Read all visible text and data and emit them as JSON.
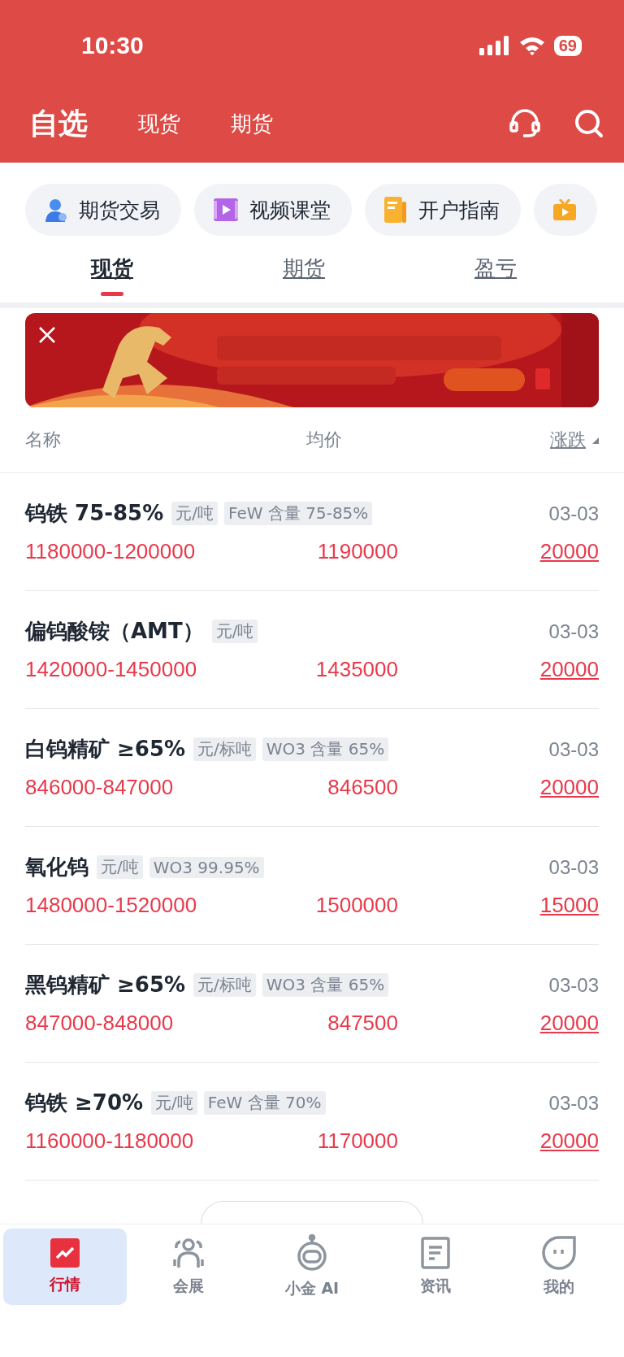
{
  "status_bar": {
    "time": "10:30",
    "battery": "69"
  },
  "header": {
    "tabs": [
      {
        "label": "自选",
        "selected": true
      },
      {
        "label": "现货",
        "selected": false
      },
      {
        "label": "期货",
        "selected": false
      }
    ]
  },
  "shortcuts": [
    {
      "label": "期货交易",
      "kind": "person"
    },
    {
      "label": "视频课堂",
      "kind": "video"
    },
    {
      "label": "开户指南",
      "kind": "doc"
    },
    {
      "kind": "tv"
    }
  ],
  "sub_tabs": [
    {
      "label": "现货",
      "selected": true
    },
    {
      "label": "期货",
      "selected": false
    },
    {
      "label": "盈亏",
      "selected": false
    }
  ],
  "table": {
    "columns": [
      "名称",
      "均价",
      "涨跌"
    ],
    "rows": [
      {
        "name": "钨铁 75-85%",
        "tags": [
          "元/吨",
          "FeW 含量 75-85%"
        ],
        "date": "03-03",
        "range": "1180000-1200000",
        "average": "1190000",
        "change": "20000"
      },
      {
        "name": "偏钨酸铵（AMT）",
        "tags": [
          "元/吨"
        ],
        "date": "03-03",
        "range": "1420000-1450000",
        "average": "1435000",
        "change": "20000"
      },
      {
        "name": "白钨精矿 ≥65%",
        "tags": [
          "元/标吨",
          "WO3 含量 65%"
        ],
        "date": "03-03",
        "range": "846000-847000",
        "average": "846500",
        "change": "20000"
      },
      {
        "name": "氧化钨",
        "tags": [
          "元/吨",
          "WO3 99.95%"
        ],
        "date": "03-03",
        "range": "1480000-1520000",
        "average": "1500000",
        "change": "15000"
      },
      {
        "name": "黑钨精矿 ≥65%",
        "tags": [
          "元/标吨",
          "WO3 含量 65%"
        ],
        "date": "03-03",
        "range": "847000-848000",
        "average": "847500",
        "change": "20000"
      },
      {
        "name": "钨铁 ≥70%",
        "tags": [
          "元/吨",
          "FeW 含量 70%"
        ],
        "date": "03-03",
        "range": "1160000-1180000",
        "average": "1170000",
        "change": "20000"
      }
    ]
  },
  "bottom_nav": [
    {
      "label": "行情",
      "kind": "chart",
      "selected": true
    },
    {
      "label": "会展",
      "kind": "people",
      "selected": false
    },
    {
      "label": "小金 AI",
      "kind": "robot",
      "selected": false
    },
    {
      "label": "资讯",
      "kind": "news",
      "selected": false
    },
    {
      "label": "我的",
      "kind": "face",
      "selected": false
    }
  ]
}
